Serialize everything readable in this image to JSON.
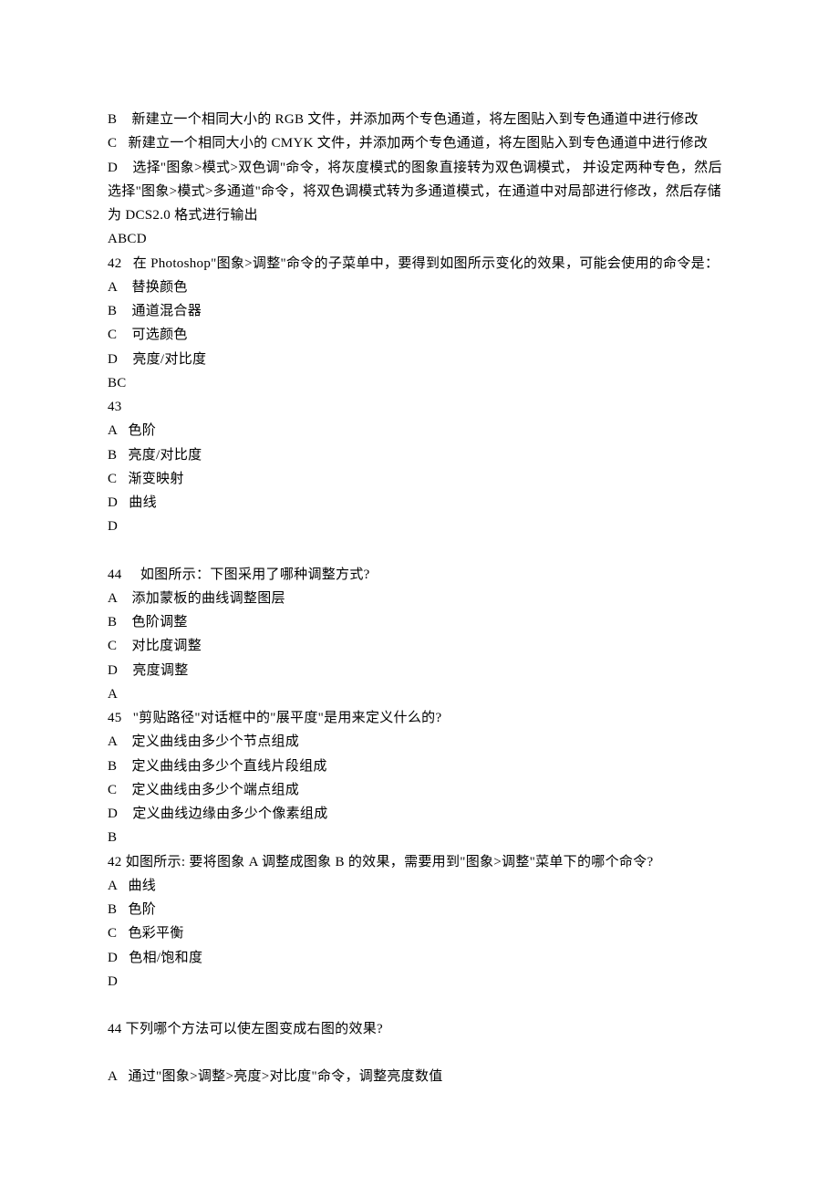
{
  "lines": [
    "B    新建立一个相同大小的 RGB 文件，并添加两个专色通道，将左图贴入到专色通道中进行修改",
    "C   新建立一个相同大小的 CMYK 文件，并添加两个专色通道，将左图贴入到专色通道中进行修改",
    "D    选择\"图象>模式>双色调\"命令，将灰度模式的图象直接转为双色调模式， 并设定两种专色，然后选择\"图象>模式>多通道\"命令，将双色调模式转为多通道模式，在通道中对局部进行修改，然后存储为 DCS2.0 格式进行输出",
    "ABCD",
    "42   在 Photoshop\"图象>调整\"命令的子菜单中，要得到如图所示变化的效果，可能会使用的命令是：",
    "A    替换颜色",
    "B    通道混合器",
    "C    可选颜色",
    "D    亮度/对比度",
    "BC",
    "43",
    "A   色阶",
    "B   亮度/对比度",
    "C   渐变映射",
    "D   曲线",
    "D",
    "",
    "44     如图所示：下图采用了哪种调整方式?",
    "A    添加蒙板的曲线调整图层",
    "B    色阶调整",
    "C    对比度调整",
    "D    亮度调整",
    "A",
    "45   \"剪贴路径\"对话框中的\"展平度\"是用来定义什么的?",
    "A    定义曲线由多少个节点组成",
    "B    定义曲线由多少个直线片段组成",
    "C    定义曲线由多少个端点组成",
    "D    定义曲线边缘由多少个像素组成",
    "B",
    "42 如图所示: 要将图象 A 调整成图象 B 的效果，需要用到\"图象>调整\"菜单下的哪个命令?",
    "A   曲线",
    "B   色阶",
    "C   色彩平衡",
    "D   色相/饱和度",
    "D",
    "",
    "44 下列哪个方法可以使左图变成右图的效果?",
    "",
    "A   通过\"图象>调整>亮度>对比度\"命令，调整亮度数值"
  ]
}
